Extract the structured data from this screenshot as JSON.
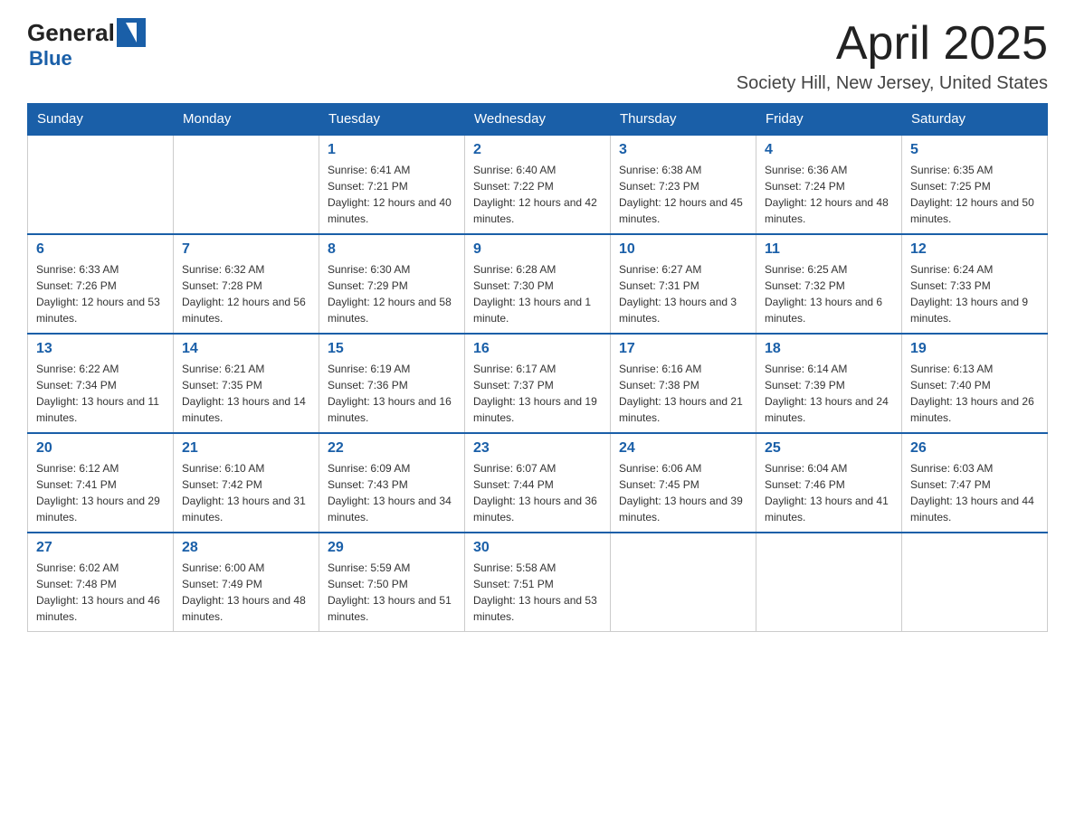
{
  "header": {
    "logo_general": "General",
    "logo_blue": "Blue",
    "month_title": "April 2025",
    "location": "Society Hill, New Jersey, United States"
  },
  "days_of_week": [
    "Sunday",
    "Monday",
    "Tuesday",
    "Wednesday",
    "Thursday",
    "Friday",
    "Saturday"
  ],
  "weeks": [
    [
      {
        "day": "",
        "sunrise": "",
        "sunset": "",
        "daylight": ""
      },
      {
        "day": "",
        "sunrise": "",
        "sunset": "",
        "daylight": ""
      },
      {
        "day": "1",
        "sunrise": "Sunrise: 6:41 AM",
        "sunset": "Sunset: 7:21 PM",
        "daylight": "Daylight: 12 hours and 40 minutes."
      },
      {
        "day": "2",
        "sunrise": "Sunrise: 6:40 AM",
        "sunset": "Sunset: 7:22 PM",
        "daylight": "Daylight: 12 hours and 42 minutes."
      },
      {
        "day": "3",
        "sunrise": "Sunrise: 6:38 AM",
        "sunset": "Sunset: 7:23 PM",
        "daylight": "Daylight: 12 hours and 45 minutes."
      },
      {
        "day": "4",
        "sunrise": "Sunrise: 6:36 AM",
        "sunset": "Sunset: 7:24 PM",
        "daylight": "Daylight: 12 hours and 48 minutes."
      },
      {
        "day": "5",
        "sunrise": "Sunrise: 6:35 AM",
        "sunset": "Sunset: 7:25 PM",
        "daylight": "Daylight: 12 hours and 50 minutes."
      }
    ],
    [
      {
        "day": "6",
        "sunrise": "Sunrise: 6:33 AM",
        "sunset": "Sunset: 7:26 PM",
        "daylight": "Daylight: 12 hours and 53 minutes."
      },
      {
        "day": "7",
        "sunrise": "Sunrise: 6:32 AM",
        "sunset": "Sunset: 7:28 PM",
        "daylight": "Daylight: 12 hours and 56 minutes."
      },
      {
        "day": "8",
        "sunrise": "Sunrise: 6:30 AM",
        "sunset": "Sunset: 7:29 PM",
        "daylight": "Daylight: 12 hours and 58 minutes."
      },
      {
        "day": "9",
        "sunrise": "Sunrise: 6:28 AM",
        "sunset": "Sunset: 7:30 PM",
        "daylight": "Daylight: 13 hours and 1 minute."
      },
      {
        "day": "10",
        "sunrise": "Sunrise: 6:27 AM",
        "sunset": "Sunset: 7:31 PM",
        "daylight": "Daylight: 13 hours and 3 minutes."
      },
      {
        "day": "11",
        "sunrise": "Sunrise: 6:25 AM",
        "sunset": "Sunset: 7:32 PM",
        "daylight": "Daylight: 13 hours and 6 minutes."
      },
      {
        "day": "12",
        "sunrise": "Sunrise: 6:24 AM",
        "sunset": "Sunset: 7:33 PM",
        "daylight": "Daylight: 13 hours and 9 minutes."
      }
    ],
    [
      {
        "day": "13",
        "sunrise": "Sunrise: 6:22 AM",
        "sunset": "Sunset: 7:34 PM",
        "daylight": "Daylight: 13 hours and 11 minutes."
      },
      {
        "day": "14",
        "sunrise": "Sunrise: 6:21 AM",
        "sunset": "Sunset: 7:35 PM",
        "daylight": "Daylight: 13 hours and 14 minutes."
      },
      {
        "day": "15",
        "sunrise": "Sunrise: 6:19 AM",
        "sunset": "Sunset: 7:36 PM",
        "daylight": "Daylight: 13 hours and 16 minutes."
      },
      {
        "day": "16",
        "sunrise": "Sunrise: 6:17 AM",
        "sunset": "Sunset: 7:37 PM",
        "daylight": "Daylight: 13 hours and 19 minutes."
      },
      {
        "day": "17",
        "sunrise": "Sunrise: 6:16 AM",
        "sunset": "Sunset: 7:38 PM",
        "daylight": "Daylight: 13 hours and 21 minutes."
      },
      {
        "day": "18",
        "sunrise": "Sunrise: 6:14 AM",
        "sunset": "Sunset: 7:39 PM",
        "daylight": "Daylight: 13 hours and 24 minutes."
      },
      {
        "day": "19",
        "sunrise": "Sunrise: 6:13 AM",
        "sunset": "Sunset: 7:40 PM",
        "daylight": "Daylight: 13 hours and 26 minutes."
      }
    ],
    [
      {
        "day": "20",
        "sunrise": "Sunrise: 6:12 AM",
        "sunset": "Sunset: 7:41 PM",
        "daylight": "Daylight: 13 hours and 29 minutes."
      },
      {
        "day": "21",
        "sunrise": "Sunrise: 6:10 AM",
        "sunset": "Sunset: 7:42 PM",
        "daylight": "Daylight: 13 hours and 31 minutes."
      },
      {
        "day": "22",
        "sunrise": "Sunrise: 6:09 AM",
        "sunset": "Sunset: 7:43 PM",
        "daylight": "Daylight: 13 hours and 34 minutes."
      },
      {
        "day": "23",
        "sunrise": "Sunrise: 6:07 AM",
        "sunset": "Sunset: 7:44 PM",
        "daylight": "Daylight: 13 hours and 36 minutes."
      },
      {
        "day": "24",
        "sunrise": "Sunrise: 6:06 AM",
        "sunset": "Sunset: 7:45 PM",
        "daylight": "Daylight: 13 hours and 39 minutes."
      },
      {
        "day": "25",
        "sunrise": "Sunrise: 6:04 AM",
        "sunset": "Sunset: 7:46 PM",
        "daylight": "Daylight: 13 hours and 41 minutes."
      },
      {
        "day": "26",
        "sunrise": "Sunrise: 6:03 AM",
        "sunset": "Sunset: 7:47 PM",
        "daylight": "Daylight: 13 hours and 44 minutes."
      }
    ],
    [
      {
        "day": "27",
        "sunrise": "Sunrise: 6:02 AM",
        "sunset": "Sunset: 7:48 PM",
        "daylight": "Daylight: 13 hours and 46 minutes."
      },
      {
        "day": "28",
        "sunrise": "Sunrise: 6:00 AM",
        "sunset": "Sunset: 7:49 PM",
        "daylight": "Daylight: 13 hours and 48 minutes."
      },
      {
        "day": "29",
        "sunrise": "Sunrise: 5:59 AM",
        "sunset": "Sunset: 7:50 PM",
        "daylight": "Daylight: 13 hours and 51 minutes."
      },
      {
        "day": "30",
        "sunrise": "Sunrise: 5:58 AM",
        "sunset": "Sunset: 7:51 PM",
        "daylight": "Daylight: 13 hours and 53 minutes."
      },
      {
        "day": "",
        "sunrise": "",
        "sunset": "",
        "daylight": ""
      },
      {
        "day": "",
        "sunrise": "",
        "sunset": "",
        "daylight": ""
      },
      {
        "day": "",
        "sunrise": "",
        "sunset": "",
        "daylight": ""
      }
    ]
  ]
}
